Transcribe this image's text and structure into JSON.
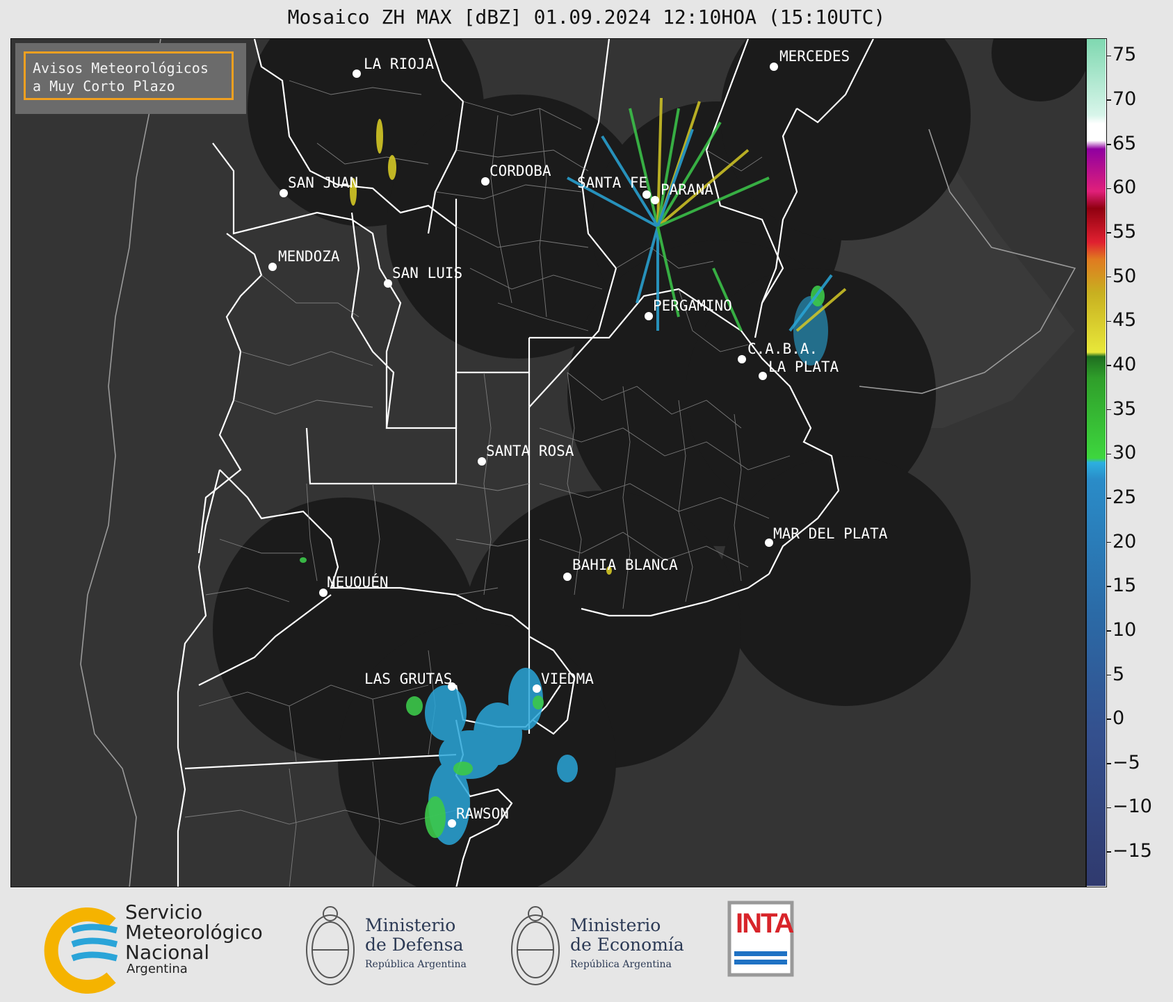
{
  "title": "Mosaico ZH MAX [dBZ] 01.09.2024 12:10HOA (15:10UTC)",
  "avisos": {
    "line1": "Avisos Meteorológicos",
    "line2": "a Muy Corto Plazo"
  },
  "colorbar": {
    "ticks": [
      "75",
      "70",
      "65",
      "60",
      "55",
      "50",
      "45",
      "40",
      "35",
      "30",
      "25",
      "20",
      "15",
      "10",
      "5",
      "0",
      "−5",
      "−10",
      "−15"
    ],
    "range": [
      -19,
      77
    ]
  },
  "cities": [
    {
      "name": "LA RIOJA"
    },
    {
      "name": "MERCEDES"
    },
    {
      "name": "CORDOBA"
    },
    {
      "name": "SAN JUAN"
    },
    {
      "name": "SANTA FE"
    },
    {
      "name": "PARANA"
    },
    {
      "name": "MENDOZA"
    },
    {
      "name": "SAN LUIS"
    },
    {
      "name": "PERGAMINO"
    },
    {
      "name": "C.A.B.A."
    },
    {
      "name": "LA PLATA"
    },
    {
      "name": "SANTA ROSA"
    },
    {
      "name": "MAR DEL PLATA"
    },
    {
      "name": "BAHIA BLANCA"
    },
    {
      "name": "NEUQUÉN"
    },
    {
      "name": "LAS GRUTAS"
    },
    {
      "name": "VIEDMA"
    },
    {
      "name": "RAWSON"
    }
  ],
  "logos": {
    "smn": {
      "line1": "Servicio",
      "line2": "Meteorológico",
      "line3": "Nacional",
      "sub": "Argentina"
    },
    "defensa": {
      "line1": "Ministerio",
      "line2": "de Defensa",
      "sub": "República Argentina"
    },
    "economia": {
      "line1": "Ministerio",
      "line2": "de Economía",
      "sub": "República Argentina"
    },
    "inta": {
      "text": "INTA"
    }
  },
  "colors": {
    "map_bg": "#333333",
    "radar_bg": "#1c1c1c",
    "boundary": "#ffffff",
    "accent": "#f0a020"
  }
}
